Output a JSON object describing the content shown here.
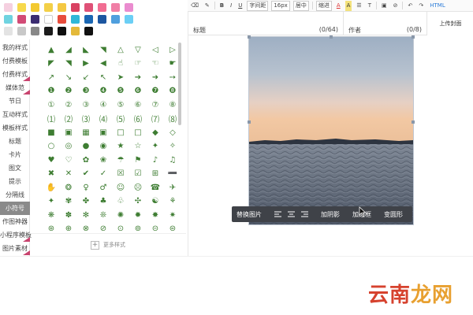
{
  "palette": {
    "colors": [
      [
        "#f5d0e0",
        "#f7d94c",
        "#f3c930",
        "#f3d048",
        "#f4c842",
        "#d94262",
        "#df5177",
        "#f16d92",
        "#f07fa6",
        "#ea8ccf"
      ],
      [
        "#6fd3e0",
        "#d24b76",
        "#3b2c71",
        "#fff",
        "#e74c3c",
        "#2fb7d8",
        "#1a66b3",
        "#1c56a0",
        "#4f9fde",
        "#6bcff5"
      ],
      [
        "#e3e3e3",
        "#c8c8c8",
        "#888888",
        "#1b1b1b",
        "#0f0f0f",
        "#e4b93a",
        "#111111",
        "",
        "",
        ""
      ]
    ]
  },
  "sidebar": {
    "items": [
      {
        "label": "我的样式",
        "flag": false
      },
      {
        "label": "付费模板",
        "flag": false
      },
      {
        "label": "付费样式",
        "flag": true
      },
      {
        "label": "媒体范",
        "flag": true
      },
      {
        "label": "节日",
        "flag": false
      },
      {
        "label": "互动样式",
        "flag": false
      },
      {
        "label": "模板样式",
        "flag": false
      },
      {
        "label": "标题",
        "flag": false
      },
      {
        "label": "卡片",
        "flag": false
      },
      {
        "label": "图文",
        "flag": false
      },
      {
        "label": "提示",
        "flag": false
      },
      {
        "label": "分隔线",
        "flag": false
      },
      {
        "label": "小符号",
        "flag": false,
        "active": true
      },
      {
        "label": "作图神器",
        "flag": false
      },
      {
        "label": "小程序模板",
        "flag": true
      },
      {
        "label": "图片素材",
        "flag": true
      }
    ]
  },
  "symbols": [
    [
      "▲",
      "◢",
      "◣",
      "◥",
      "△",
      "▽",
      "◁",
      "▷"
    ],
    [
      "◤",
      "◥",
      "▶",
      "◀",
      "☝",
      "☞",
      "☜",
      "☛"
    ],
    [
      "↗",
      "↘",
      "↙",
      "↖",
      "➤",
      "➔",
      "➜",
      "➙"
    ],
    [
      "❶",
      "❷",
      "❸",
      "❹",
      "❺",
      "❻",
      "❼",
      "❽"
    ],
    [
      "①",
      "②",
      "③",
      "④",
      "⑤",
      "⑥",
      "⑦",
      "⑧"
    ],
    [
      "⑴",
      "⑵",
      "⑶",
      "⑷",
      "⑸",
      "⑹",
      "⑺",
      "⑻"
    ],
    [
      "■",
      "▣",
      "▦",
      "▣",
      "□",
      "□",
      "◆",
      "◇"
    ],
    [
      "○",
      "◎",
      "●",
      "◉",
      "★",
      "☆",
      "✦",
      "✧"
    ],
    [
      "♥",
      "♡",
      "✿",
      "❀",
      "☂",
      "⚑",
      "♪",
      "♫"
    ],
    [
      "✖",
      "✕",
      "✔",
      "✓",
      "☒",
      "☑",
      "⊞",
      "➖"
    ],
    [
      "✋",
      "❂",
      "♀",
      "♂",
      "☺",
      "☹",
      "☎",
      "✈"
    ],
    [
      "✦",
      "✾",
      "✤",
      "♣",
      "♧",
      "✣",
      "☯",
      "⚘"
    ],
    [
      "❋",
      "✽",
      "✻",
      "❊",
      "✺",
      "✹",
      "✸",
      "✷"
    ],
    [
      "⊛",
      "⊕",
      "⊗",
      "⊘",
      "⊙",
      "⊚",
      "⊝",
      "⊜"
    ]
  ],
  "more_label": "更多样式",
  "toolbar": {
    "bold": "B",
    "italic": "I",
    "underline": "U",
    "spacing": "字间距",
    "fontsize": "16px",
    "align": "居中",
    "indent": "缩进",
    "font_color": "A",
    "bg_color": "A",
    "list": "☰",
    "textstyle": "T",
    "html": "HTML"
  },
  "fields": {
    "title_label": "标题",
    "title_count": "(0/64)",
    "author_label": "作者",
    "author_count": "(0/8)",
    "cover_button": "上传封面"
  },
  "image_toolbar": {
    "replace": "替换图片",
    "shadow": "加阴影",
    "border": "加边框",
    "transform": "变圆形"
  },
  "watermark": {
    "part1": "云南",
    "part2": "龙网"
  }
}
